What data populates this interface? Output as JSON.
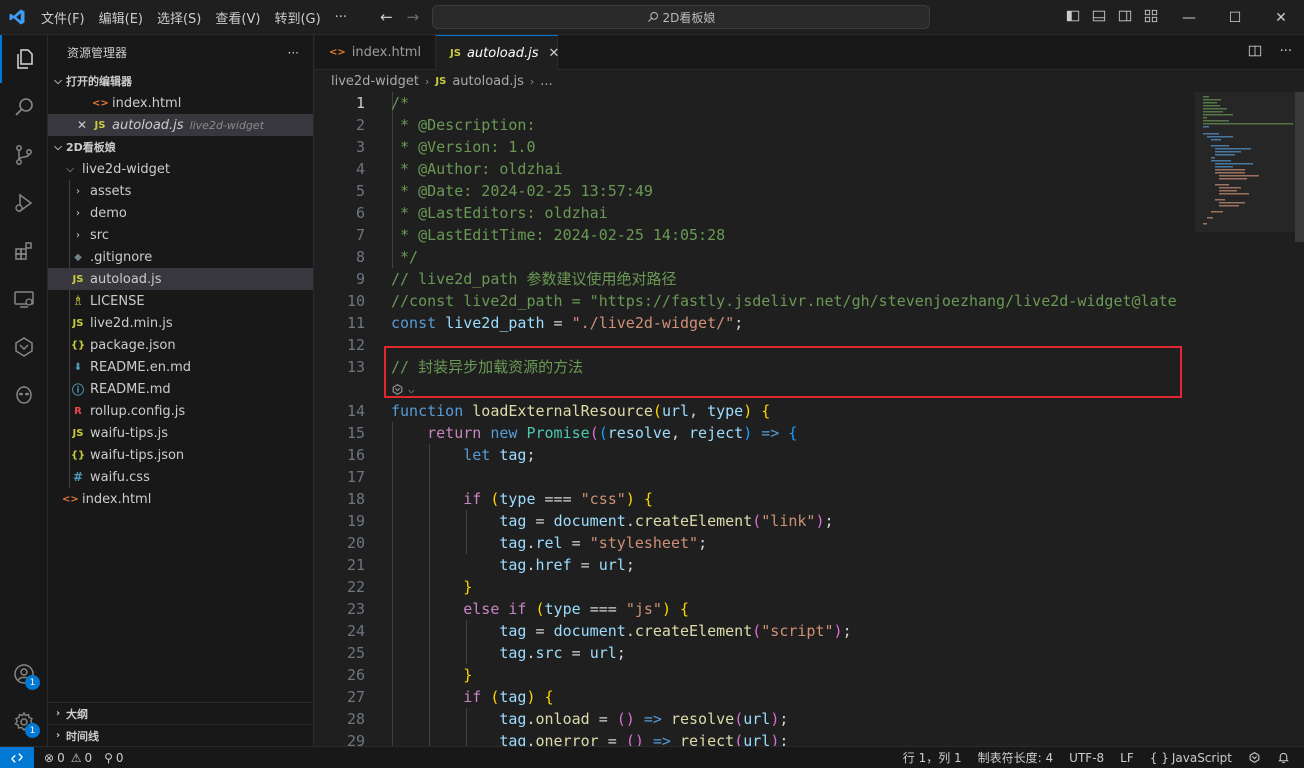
{
  "titlebar": {
    "menus": [
      "文件(F)",
      "编辑(E)",
      "选择(S)",
      "查看(V)",
      "转到(G)",
      "···"
    ],
    "search_text": "2D看板娘",
    "window_controls": [
      "minimize",
      "maximize",
      "close"
    ]
  },
  "activity": {
    "items": [
      "explorer-icon",
      "search-icon",
      "source-control-icon",
      "run-debug-icon",
      "extensions-icon",
      "remote-explorer-icon",
      "ai-icon",
      "alien-icon"
    ],
    "accounts_badge": "1",
    "settings_badge": "1"
  },
  "sidebar": {
    "title": "资源管理器",
    "more": "···",
    "open_editors_label": "打开的编辑器",
    "open_editors": [
      {
        "name": "index.html",
        "icon": "<>",
        "icon_color": "#e37933"
      },
      {
        "name": "autoload.js",
        "icon": "JS",
        "icon_color": "#cbcb41",
        "desc": "live2d-widget",
        "close": "✕"
      }
    ],
    "workspace_label": "2D看板娘",
    "folder": "live2d-widget",
    "items": [
      {
        "name": "assets",
        "type": "folder"
      },
      {
        "name": "demo",
        "type": "folder"
      },
      {
        "name": "src",
        "type": "folder"
      },
      {
        "name": ".gitignore",
        "icon": "◆",
        "icon_color": "#41535b"
      },
      {
        "name": "autoload.js",
        "icon": "JS",
        "icon_color": "#cbcb41"
      },
      {
        "name": "LICENSE",
        "icon": "♗",
        "icon_color": "#cbcb41"
      },
      {
        "name": "live2d.min.js",
        "icon": "JS",
        "icon_color": "#cbcb41"
      },
      {
        "name": "package.json",
        "icon": "{}",
        "icon_color": "#cbcb41"
      },
      {
        "name": "README.en.md",
        "icon": "⬇",
        "icon_color": "#519aba"
      },
      {
        "name": "README.md",
        "icon": "ⓘ",
        "icon_color": "#519aba"
      },
      {
        "name": "rollup.config.js",
        "icon": "R",
        "icon_color": "#e5474b"
      },
      {
        "name": "waifu-tips.js",
        "icon": "JS",
        "icon_color": "#cbcb41"
      },
      {
        "name": "waifu-tips.json",
        "icon": "{}",
        "icon_color": "#cbcb41"
      },
      {
        "name": "waifu.css",
        "icon": "#",
        "icon_color": "#519aba"
      }
    ],
    "root_file": {
      "name": "index.html",
      "icon": "<>",
      "icon_color": "#e37933"
    },
    "outline_label": "大纲",
    "timeline_label": "时间线"
  },
  "editor": {
    "tabs": [
      {
        "name": "index.html",
        "icon": "<>",
        "icon_color": "#e37933"
      },
      {
        "name": "autoload.js",
        "icon": "JS",
        "icon_color": "#cbcb41",
        "close": "✕"
      }
    ],
    "breadcrumb": {
      "folder": "live2d-widget",
      "file_icon": "JS",
      "file": "autoload.js",
      "more": "..."
    },
    "line_numbers": [
      "1",
      "2",
      "3",
      "4",
      "5",
      "6",
      "7",
      "8",
      "9",
      "10",
      "11",
      "12",
      "13",
      "14",
      "15",
      "16",
      "17",
      "18",
      "19",
      "20",
      "21",
      "22",
      "23",
      "24",
      "25",
      "26",
      "27",
      "28",
      "29"
    ],
    "code": {
      "l1": "/*",
      "l2": " * @Description:",
      "l3": " * @Version: 1.0",
      "l4": " * @Author: oldzhai",
      "l5": " * @Date: 2024-02-25 13:57:49",
      "l6": " * @LastEditors: oldzhai",
      "l7": " * @LastEditTime: 2024-02-25 14:05:28",
      "l8": " */",
      "l9": "// live2d_path 参数建议使用绝对路径",
      "l10": "//const live2d_path = \"https://fastly.jsdelivr.net/gh/stevenjoezhang/live2d-widget@late",
      "l11_kw": "const",
      "l11_var": "live2d_path",
      "l11_eq": " = ",
      "l11_str": "\"./live2d-widget/\"",
      "l11_end": ";",
      "l13": "// 封装异步加载资源的方法",
      "l14_kw": "function",
      "l14_fn": "loadExternalResource",
      "l14_a1": "url",
      "l14_a2": "type",
      "l15_ret": "return",
      "l15_new": "new",
      "l15_cls": "Promise",
      "l15_a1": "resolve",
      "l15_a2": "reject",
      "l15_arrow": "=>",
      "l16_kw": "let",
      "l16_var": "tag",
      "l18_if": "if",
      "l18_var": "type",
      "l18_op": "===",
      "l18_str": "\"css\"",
      "l19_var": "tag",
      "l19_doc": "document",
      "l19_fn": "createElement",
      "l19_str": "\"link\"",
      "l20_var": "tag",
      "l20_prop": "rel",
      "l20_str": "\"stylesheet\"",
      "l21_var": "tag",
      "l21_prop": "href",
      "l21_val": "url",
      "l23_else": "else",
      "l23_if": "if",
      "l23_var": "type",
      "l23_op": "===",
      "l23_str": "\"js\"",
      "l24_var": "tag",
      "l24_doc": "document",
      "l24_fn": "createElement",
      "l24_str": "\"script\"",
      "l25_var": "tag",
      "l25_prop": "src",
      "l25_val": "url",
      "l27_if": "if",
      "l27_var": "tag",
      "l28_var": "tag",
      "l28_prop": "onload",
      "l28_arrow": "=>",
      "l28_fn": "resolve",
      "l28_arg": "url",
      "l29_var": "tag",
      "l29_prop": "onerror",
      "l29_arrow": "=>",
      "l29_fn": "reject",
      "l29_arg": "url"
    }
  },
  "statusbar": {
    "remote_icon": "remote-icon",
    "errors": "0",
    "warnings": "0",
    "ports": "0",
    "position": "行 1，列 1",
    "tab_size": "制表符长度: 4",
    "encoding": "UTF-8",
    "eol": "LF",
    "language_icon": "{ }",
    "language": "JavaScript"
  },
  "colors": {
    "accent": "#0078d4",
    "highlight_box": "#e0282e"
  }
}
